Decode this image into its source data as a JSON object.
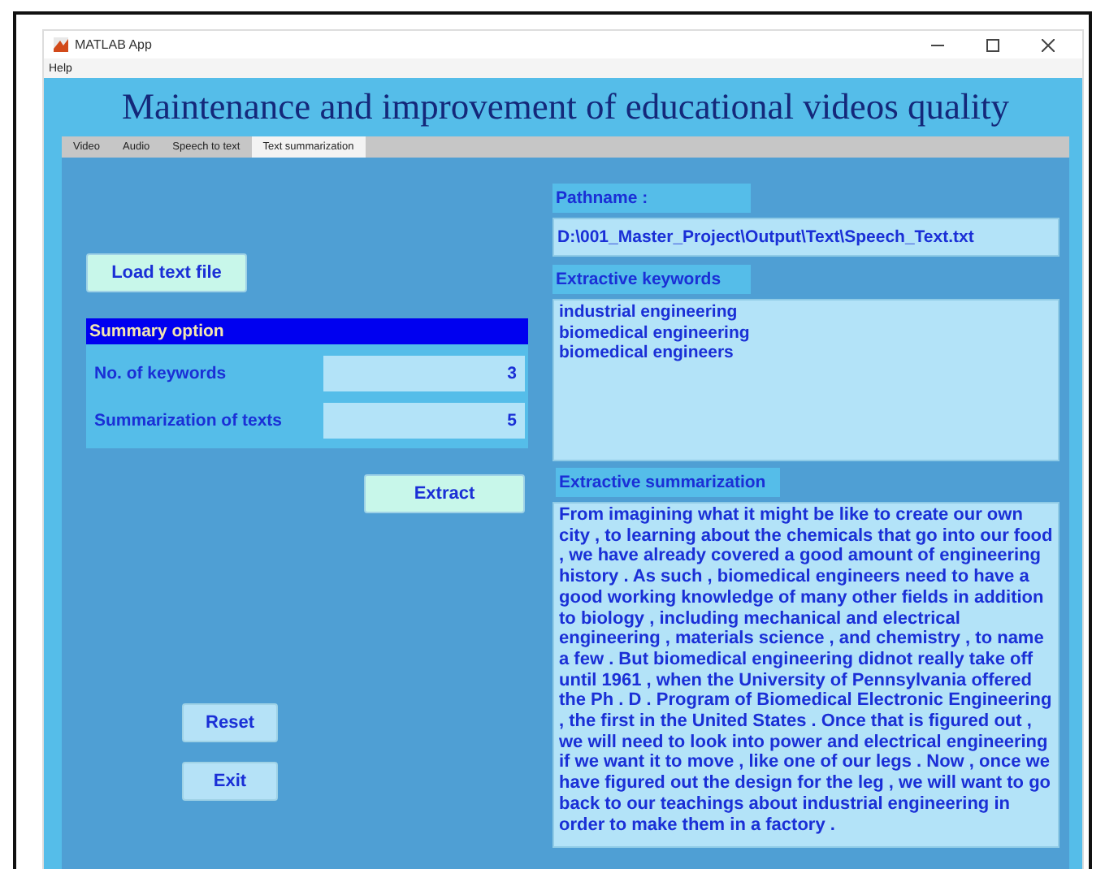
{
  "window": {
    "title": "MATLAB App"
  },
  "menu": [
    "Help"
  ],
  "heading": "Maintenance and improvement of educational videos quality",
  "tabs": [
    {
      "label": "Video",
      "selected": false
    },
    {
      "label": "Audio",
      "selected": false
    },
    {
      "label": "Speech to text",
      "selected": false
    },
    {
      "label": "Text summarization",
      "selected": true
    }
  ],
  "load_button": "Load text file",
  "summary_option": {
    "title": "Summary option",
    "fields": [
      {
        "label": "No. of keywords",
        "value": "3"
      },
      {
        "label": "Summarization of texts",
        "value": "5"
      }
    ]
  },
  "extract_button": "Extract",
  "reset_button": "Reset",
  "exit_button": "Exit",
  "pathname": {
    "label": "Pathname :",
    "value": "D:\\001_Master_Project\\Output\\Text\\Speech_Text.txt"
  },
  "keywords": {
    "label": "Extractive keywords",
    "lines": [
      "industrial engineering",
      "biomedical engineering",
      "biomedical engineers"
    ]
  },
  "summarization": {
    "label": "Extractive summarization",
    "text": "From imagining what it might be like to create our own city , to learning about the chemicals that go into our food , we have already covered a good amount of engineering history . As such , biomedical engineers need to have a good working knowledge of many other fields in addition to biology , including mechanical and electrical engineering , materials science , and chemistry , to name a few . But biomedical engineering didnot really take off until 1961 , when the University of Pennsylvania offered the Ph . D . Program of Biomedical Electronic Engineering , the first in the United States . Once that is figured out , we will need to look into power and electrical engineering if we want it to move , like one of our legs . Now , once we have figured out the design for the leg , we will want to go back to our teachings about industrial engineering in order to make them in a factory ."
  }
}
